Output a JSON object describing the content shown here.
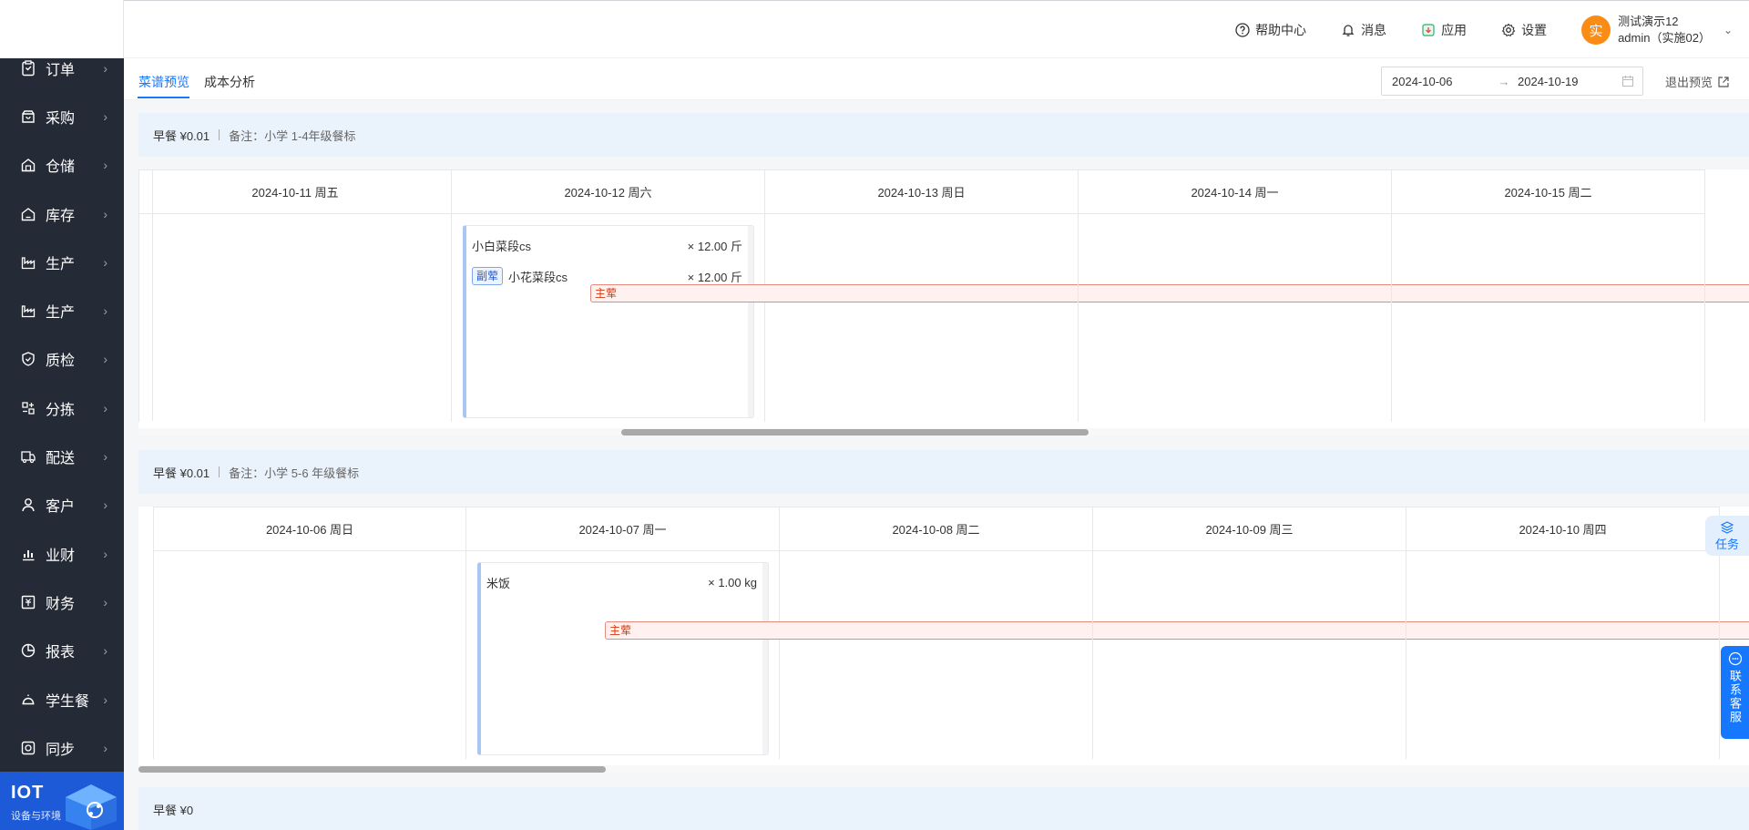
{
  "sidebar": {
    "items": [
      {
        "label": "订单",
        "icon": "clipboard-icon"
      },
      {
        "label": "采购",
        "icon": "store-icon"
      },
      {
        "label": "仓储",
        "icon": "warehouse-icon"
      },
      {
        "label": "库存",
        "icon": "inventory-icon"
      },
      {
        "label": "生产",
        "icon": "factory-icon"
      },
      {
        "label": "生产",
        "icon": "factory-icon"
      },
      {
        "label": "质检",
        "icon": "shield-check-icon"
      },
      {
        "label": "分拣",
        "icon": "sort-icon"
      },
      {
        "label": "配送",
        "icon": "truck-icon"
      },
      {
        "label": "客户",
        "icon": "user-icon"
      },
      {
        "label": "业财",
        "icon": "chart-icon"
      },
      {
        "label": "财务",
        "icon": "finance-icon"
      },
      {
        "label": "报表",
        "icon": "report-icon"
      },
      {
        "label": "学生餐",
        "icon": "meal-cover-icon"
      },
      {
        "label": "同步",
        "icon": "sync-icon"
      }
    ],
    "iot": {
      "title": "IOT",
      "subtitle": "设备与环境"
    }
  },
  "header": {
    "help": "帮助中心",
    "messages": "消息",
    "apps": "应用",
    "settings": "设置",
    "user": {
      "avatar": "实",
      "name": "测试演示12",
      "account": "admin（实施02）"
    }
  },
  "subnav": {
    "tabs": [
      "菜谱预览",
      "成本分析"
    ],
    "active_tab": 0,
    "date_start": "2024-10-06",
    "date_end": "2024-10-19",
    "date_arrow": "→",
    "exit_preview": "退出预览"
  },
  "sections": [
    {
      "meal": "早餐 ¥0.01",
      "note": "备注：小学 1-4年级餐标",
      "days": [
        {
          "label": "2024-10-11 周五",
          "dishes": []
        },
        {
          "label": "2024-10-12 周六",
          "dishes": [
            {
              "tag": "主荤",
              "tag_type": "main",
              "name": "小白菜段cs",
              "qty": "× 12.00 斤"
            },
            {
              "tag": "副荤",
              "tag_type": "side",
              "name": "小花菜段cs",
              "qty": "× 12.00 斤"
            }
          ]
        },
        {
          "label": "2024-10-13 周日",
          "dishes": []
        },
        {
          "label": "2024-10-14 周一",
          "dishes": []
        },
        {
          "label": "2024-10-15 周二",
          "dishes": []
        }
      ],
      "scroll_fraction_start": 0.3,
      "scroll_fraction_size": 0.29
    },
    {
      "meal": "早餐 ¥0.01",
      "note": "备注：小学 5-6 年级餐标",
      "days": [
        {
          "label": "2024-10-06 周日",
          "dishes": []
        },
        {
          "label": "2024-10-07 周一",
          "dishes": [
            {
              "tag": "主荤",
              "tag_type": "main",
              "name": "米饭",
              "qty": "× 1.00 kg"
            }
          ]
        },
        {
          "label": "2024-10-08 周二",
          "dishes": []
        },
        {
          "label": "2024-10-09 周三",
          "dishes": []
        },
        {
          "label": "2024-10-10 周四",
          "dishes": []
        }
      ],
      "scroll_fraction_start": 0.0,
      "scroll_fraction_size": 0.29
    },
    {
      "meal": "早餐 ¥0",
      "note": ""
    }
  ],
  "floating": {
    "task": "任务",
    "contact": "联系客服"
  },
  "colors": {
    "accent": "#1677ff",
    "sidebar_bg": "#242a36",
    "main_tag": "#d4380d",
    "side_tag": "#1d5ad8"
  }
}
